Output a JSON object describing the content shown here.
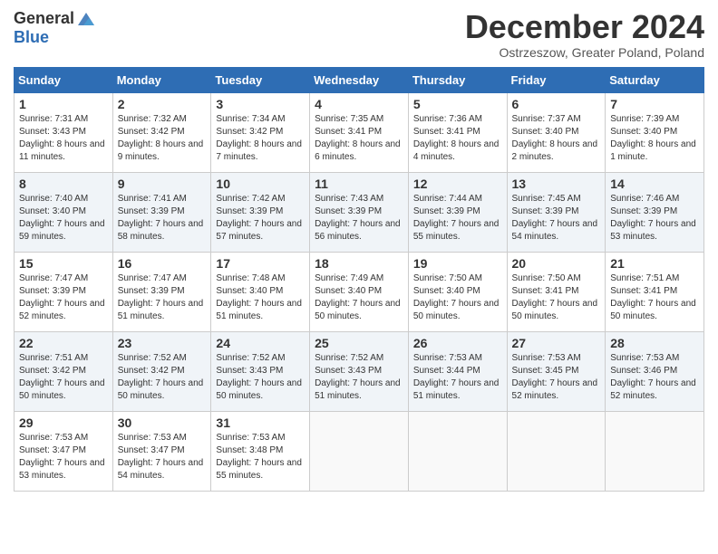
{
  "header": {
    "logo_general": "General",
    "logo_blue": "Blue",
    "month_title": "December 2024",
    "subtitle": "Ostrzeszow, Greater Poland, Poland"
  },
  "weekdays": [
    "Sunday",
    "Monday",
    "Tuesday",
    "Wednesday",
    "Thursday",
    "Friday",
    "Saturday"
  ],
  "weeks": [
    [
      {
        "day": "1",
        "sunrise": "Sunrise: 7:31 AM",
        "sunset": "Sunset: 3:43 PM",
        "daylight": "Daylight: 8 hours and 11 minutes."
      },
      {
        "day": "2",
        "sunrise": "Sunrise: 7:32 AM",
        "sunset": "Sunset: 3:42 PM",
        "daylight": "Daylight: 8 hours and 9 minutes."
      },
      {
        "day": "3",
        "sunrise": "Sunrise: 7:34 AM",
        "sunset": "Sunset: 3:42 PM",
        "daylight": "Daylight: 8 hours and 7 minutes."
      },
      {
        "day": "4",
        "sunrise": "Sunrise: 7:35 AM",
        "sunset": "Sunset: 3:41 PM",
        "daylight": "Daylight: 8 hours and 6 minutes."
      },
      {
        "day": "5",
        "sunrise": "Sunrise: 7:36 AM",
        "sunset": "Sunset: 3:41 PM",
        "daylight": "Daylight: 8 hours and 4 minutes."
      },
      {
        "day": "6",
        "sunrise": "Sunrise: 7:37 AM",
        "sunset": "Sunset: 3:40 PM",
        "daylight": "Daylight: 8 hours and 2 minutes."
      },
      {
        "day": "7",
        "sunrise": "Sunrise: 7:39 AM",
        "sunset": "Sunset: 3:40 PM",
        "daylight": "Daylight: 8 hours and 1 minute."
      }
    ],
    [
      {
        "day": "8",
        "sunrise": "Sunrise: 7:40 AM",
        "sunset": "Sunset: 3:40 PM",
        "daylight": "Daylight: 7 hours and 59 minutes."
      },
      {
        "day": "9",
        "sunrise": "Sunrise: 7:41 AM",
        "sunset": "Sunset: 3:39 PM",
        "daylight": "Daylight: 7 hours and 58 minutes."
      },
      {
        "day": "10",
        "sunrise": "Sunrise: 7:42 AM",
        "sunset": "Sunset: 3:39 PM",
        "daylight": "Daylight: 7 hours and 57 minutes."
      },
      {
        "day": "11",
        "sunrise": "Sunrise: 7:43 AM",
        "sunset": "Sunset: 3:39 PM",
        "daylight": "Daylight: 7 hours and 56 minutes."
      },
      {
        "day": "12",
        "sunrise": "Sunrise: 7:44 AM",
        "sunset": "Sunset: 3:39 PM",
        "daylight": "Daylight: 7 hours and 55 minutes."
      },
      {
        "day": "13",
        "sunrise": "Sunrise: 7:45 AM",
        "sunset": "Sunset: 3:39 PM",
        "daylight": "Daylight: 7 hours and 54 minutes."
      },
      {
        "day": "14",
        "sunrise": "Sunrise: 7:46 AM",
        "sunset": "Sunset: 3:39 PM",
        "daylight": "Daylight: 7 hours and 53 minutes."
      }
    ],
    [
      {
        "day": "15",
        "sunrise": "Sunrise: 7:47 AM",
        "sunset": "Sunset: 3:39 PM",
        "daylight": "Daylight: 7 hours and 52 minutes."
      },
      {
        "day": "16",
        "sunrise": "Sunrise: 7:47 AM",
        "sunset": "Sunset: 3:39 PM",
        "daylight": "Daylight: 7 hours and 51 minutes."
      },
      {
        "day": "17",
        "sunrise": "Sunrise: 7:48 AM",
        "sunset": "Sunset: 3:40 PM",
        "daylight": "Daylight: 7 hours and 51 minutes."
      },
      {
        "day": "18",
        "sunrise": "Sunrise: 7:49 AM",
        "sunset": "Sunset: 3:40 PM",
        "daylight": "Daylight: 7 hours and 50 minutes."
      },
      {
        "day": "19",
        "sunrise": "Sunrise: 7:50 AM",
        "sunset": "Sunset: 3:40 PM",
        "daylight": "Daylight: 7 hours and 50 minutes."
      },
      {
        "day": "20",
        "sunrise": "Sunrise: 7:50 AM",
        "sunset": "Sunset: 3:41 PM",
        "daylight": "Daylight: 7 hours and 50 minutes."
      },
      {
        "day": "21",
        "sunrise": "Sunrise: 7:51 AM",
        "sunset": "Sunset: 3:41 PM",
        "daylight": "Daylight: 7 hours and 50 minutes."
      }
    ],
    [
      {
        "day": "22",
        "sunrise": "Sunrise: 7:51 AM",
        "sunset": "Sunset: 3:42 PM",
        "daylight": "Daylight: 7 hours and 50 minutes."
      },
      {
        "day": "23",
        "sunrise": "Sunrise: 7:52 AM",
        "sunset": "Sunset: 3:42 PM",
        "daylight": "Daylight: 7 hours and 50 minutes."
      },
      {
        "day": "24",
        "sunrise": "Sunrise: 7:52 AM",
        "sunset": "Sunset: 3:43 PM",
        "daylight": "Daylight: 7 hours and 50 minutes."
      },
      {
        "day": "25",
        "sunrise": "Sunrise: 7:52 AM",
        "sunset": "Sunset: 3:43 PM",
        "daylight": "Daylight: 7 hours and 51 minutes."
      },
      {
        "day": "26",
        "sunrise": "Sunrise: 7:53 AM",
        "sunset": "Sunset: 3:44 PM",
        "daylight": "Daylight: 7 hours and 51 minutes."
      },
      {
        "day": "27",
        "sunrise": "Sunrise: 7:53 AM",
        "sunset": "Sunset: 3:45 PM",
        "daylight": "Daylight: 7 hours and 52 minutes."
      },
      {
        "day": "28",
        "sunrise": "Sunrise: 7:53 AM",
        "sunset": "Sunset: 3:46 PM",
        "daylight": "Daylight: 7 hours and 52 minutes."
      }
    ],
    [
      {
        "day": "29",
        "sunrise": "Sunrise: 7:53 AM",
        "sunset": "Sunset: 3:47 PM",
        "daylight": "Daylight: 7 hours and 53 minutes."
      },
      {
        "day": "30",
        "sunrise": "Sunrise: 7:53 AM",
        "sunset": "Sunset: 3:47 PM",
        "daylight": "Daylight: 7 hours and 54 minutes."
      },
      {
        "day": "31",
        "sunrise": "Sunrise: 7:53 AM",
        "sunset": "Sunset: 3:48 PM",
        "daylight": "Daylight: 7 hours and 55 minutes."
      },
      null,
      null,
      null,
      null
    ]
  ]
}
